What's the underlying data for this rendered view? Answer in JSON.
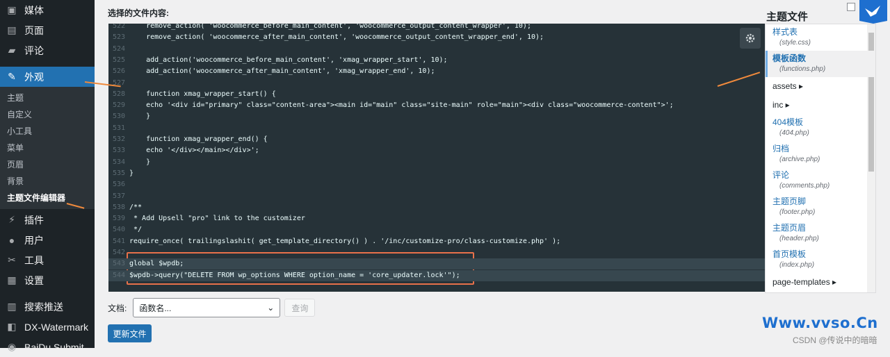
{
  "sidebar": {
    "items_top": [
      {
        "label": "媒体",
        "icon": "media-icon"
      },
      {
        "label": "页面",
        "icon": "page-icon"
      },
      {
        "label": "评论",
        "icon": "comment-icon"
      }
    ],
    "active": {
      "label": "外观",
      "icon": "brush-icon"
    },
    "submenu": [
      "主题",
      "自定义",
      "小工具",
      "菜单",
      "页眉",
      "背景",
      "主题文件编辑器"
    ],
    "submenu_current_index": 6,
    "items_bottom": [
      {
        "label": "插件",
        "icon": "plugin-icon"
      },
      {
        "label": "用户",
        "icon": "user-icon"
      },
      {
        "label": "工具",
        "icon": "wrench-icon"
      },
      {
        "label": "设置",
        "icon": "settings-icon"
      },
      {
        "label": "搜索推送",
        "icon": "push-icon"
      },
      {
        "label": "DX-Watermark",
        "icon": "watermark-icon"
      },
      {
        "label": "BaiDu Submit",
        "icon": "submit-icon"
      }
    ]
  },
  "editor": {
    "content_label": "选择的文件内容:",
    "lines": [
      {
        "n": "522",
        "t": "    remove_action( 'woocommerce_before_main_content', 'woocommerce_output_content_wrapper', 10);"
      },
      {
        "n": "523",
        "t": "    remove_action( 'woocommerce_after_main_content', 'woocommerce_output_content_wrapper_end', 10);"
      },
      {
        "n": "524",
        "t": ""
      },
      {
        "n": "525",
        "t": "    add_action('woocommerce_before_main_content', 'xmag_wrapper_start', 10);"
      },
      {
        "n": "526",
        "t": "    add_action('woocommerce_after_main_content', 'xmag_wrapper_end', 10);"
      },
      {
        "n": "527",
        "t": ""
      },
      {
        "n": "528",
        "t": "    function xmag_wrapper_start() {"
      },
      {
        "n": "529",
        "t": "    echo '<div id=\"primary\" class=\"content-area\"><main id=\"main\" class=\"site-main\" role=\"main\"><div class=\"woocommerce-content\">';"
      },
      {
        "n": "530",
        "t": "    }"
      },
      {
        "n": "531",
        "t": ""
      },
      {
        "n": "532",
        "t": "    function xmag_wrapper_end() {"
      },
      {
        "n": "533",
        "t": "    echo '</div></main></div>';"
      },
      {
        "n": "534",
        "t": "    }"
      },
      {
        "n": "535",
        "t": "}"
      },
      {
        "n": "536",
        "t": ""
      },
      {
        "n": "537",
        "t": ""
      },
      {
        "n": "538",
        "t": "/**"
      },
      {
        "n": "539",
        "t": " * Add Upsell \"pro\" link to the customizer"
      },
      {
        "n": "540",
        "t": " */"
      },
      {
        "n": "541",
        "t": "require_once( trailingslashit( get_template_directory() ) . '/inc/customize-pro/class-customize.php' );"
      },
      {
        "n": "542",
        "t": ""
      },
      {
        "n": "543",
        "t": "global $wpdb;"
      },
      {
        "n": "544",
        "t": "$wpdb->query(\"DELETE FROM wp_options WHERE option_name = 'core_updater.lock'\");"
      }
    ],
    "highlighted_lines": [
      "543",
      "544"
    ]
  },
  "files": {
    "title": "主题文件",
    "items": [
      {
        "name": "样式表",
        "sub": "(style.css)"
      },
      {
        "name": "模板函数",
        "sub": "(functions.php)",
        "current": true
      },
      {
        "name": "assets ▸",
        "folder": true
      },
      {
        "name": "inc ▸",
        "folder": true
      },
      {
        "name": "404模板",
        "sub": "(404.php)"
      },
      {
        "name": "归档",
        "sub": "(archive.php)"
      },
      {
        "name": "评论",
        "sub": "(comments.php)"
      },
      {
        "name": "主题页脚",
        "sub": "(footer.php)"
      },
      {
        "name": "主题页眉",
        "sub": "(header.php)"
      },
      {
        "name": "首页模板",
        "sub": "(index.php)"
      },
      {
        "name": "page-templates ▸",
        "folder": true
      }
    ]
  },
  "doc": {
    "label": "文档:",
    "select_value": "函数名...",
    "lookup_button": "查询"
  },
  "update_button": "更新文件",
  "watermark": "Www.vvso.Cn",
  "csdn_credit": "CSDN @传说中的暗暗",
  "colors": {
    "accent": "#2271b1",
    "editor_bg": "#263238",
    "annotation": "#f08a3c"
  }
}
